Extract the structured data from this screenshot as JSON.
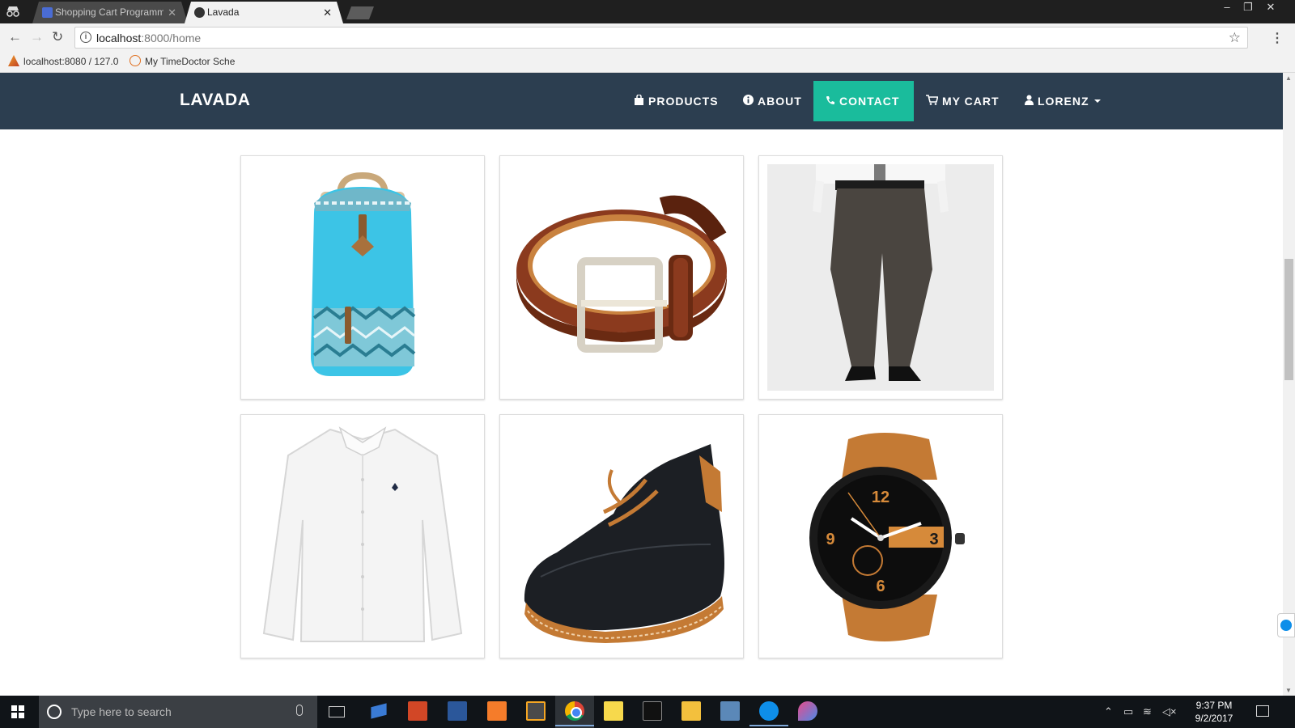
{
  "browser": {
    "tabs": [
      {
        "title": "Shopping Cart Programm",
        "active": false
      },
      {
        "title": "Lavada",
        "active": true
      }
    ],
    "url_host": "localhost",
    "url_path": ":8000/home",
    "bookmarks": [
      {
        "label": "localhost:8080 / 127.0",
        "icon": "phpmyadmin-icon"
      },
      {
        "label": "My TimeDoctor Sche",
        "icon": "timedoctor-icon"
      }
    ]
  },
  "site": {
    "brand": "LAVADA",
    "nav": [
      {
        "label": "PRODUCTS",
        "icon": "shopping-bag-icon",
        "active": false
      },
      {
        "label": "ABOUT",
        "icon": "info-icon",
        "active": false
      },
      {
        "label": "CONTACT",
        "icon": "phone-icon",
        "active": true
      },
      {
        "label": "MY CART",
        "icon": "cart-icon",
        "active": false
      },
      {
        "label": "LORENZ",
        "icon": "user-icon",
        "active": false,
        "dropdown": true
      }
    ],
    "products": [
      {
        "name": "backpack",
        "accent": "#3cc4e6"
      },
      {
        "name": "belt",
        "accent": "#8b3a1e"
      },
      {
        "name": "pants",
        "accent": "#4a4540"
      },
      {
        "name": "shirt",
        "accent": "#f4f4f4"
      },
      {
        "name": "shoe",
        "accent": "#1c1f24"
      },
      {
        "name": "watch",
        "accent": "#c47a34"
      }
    ]
  },
  "colors": {
    "navbar": "#2c3e50",
    "active_nav": "#1abc9c"
  },
  "taskbar": {
    "search_placeholder": "Type here to search",
    "time": "9:37 PM",
    "date": "9/2/2017"
  }
}
